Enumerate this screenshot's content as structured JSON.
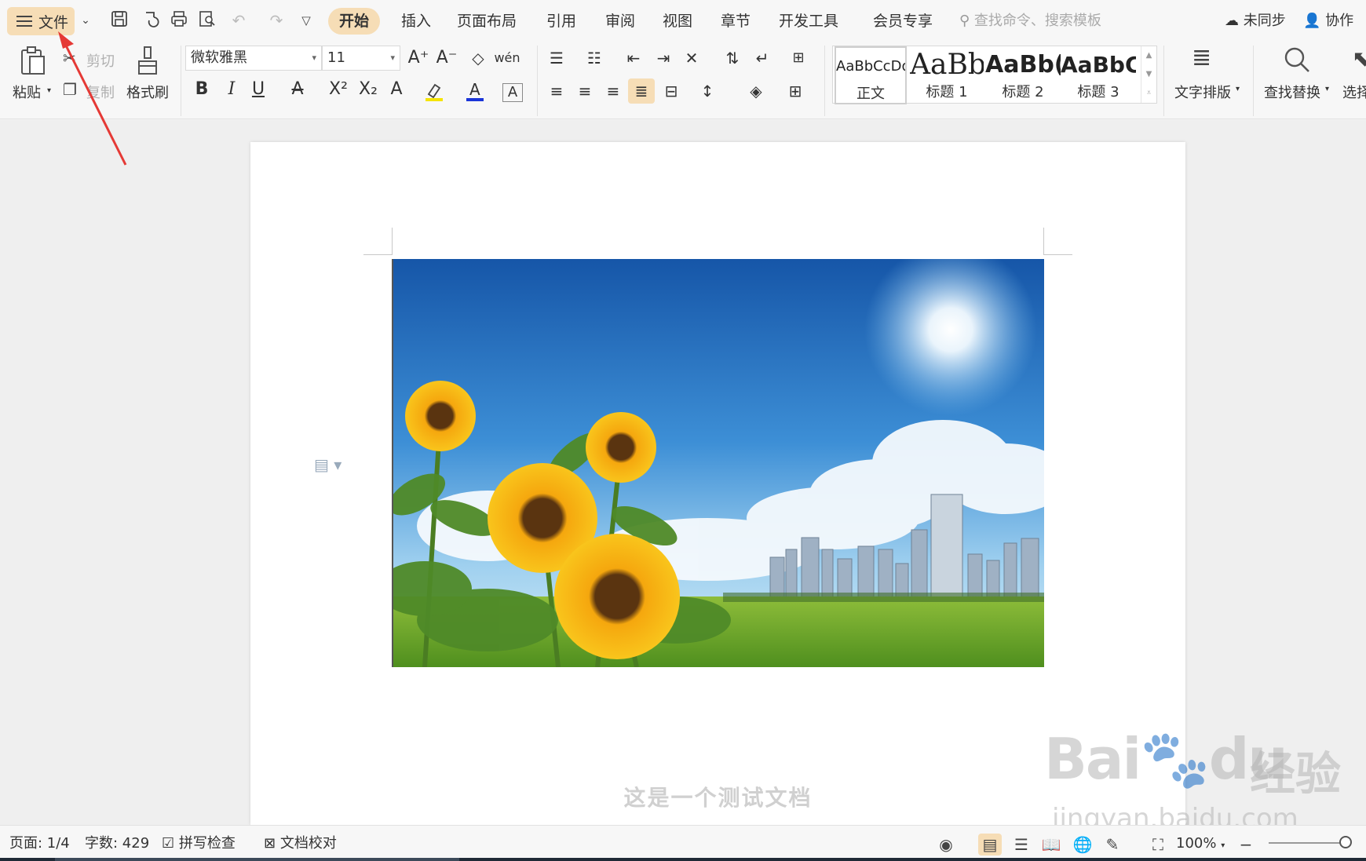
{
  "menubar": {
    "file_label": "文件",
    "tabs": [
      "开始",
      "插入",
      "页面布局",
      "引用",
      "审阅",
      "视图",
      "章节",
      "开发工具",
      "会员专享"
    ],
    "active_tab": "开始",
    "search_placeholder": "查找命令、搜索模板",
    "sync_label": "未同步",
    "collab_label": "协作"
  },
  "ribbon": {
    "paste": "粘贴",
    "cut": "剪切",
    "copy": "复制",
    "format_painter": "格式刷",
    "font_name": "微软雅黑",
    "font_size": "11",
    "styles": [
      {
        "preview": "AaBbCcDd",
        "name": "正文"
      },
      {
        "preview": "AaBb",
        "name": "标题 1"
      },
      {
        "preview": "AaBb(",
        "name": "标题 2"
      },
      {
        "preview": "AaBbC",
        "name": "标题 3"
      }
    ],
    "text_layout": "文字排版",
    "find_replace": "查找替换",
    "select": "选择",
    "font_color_accent": "#1a35d8",
    "highlight_accent": "#f5e400"
  },
  "document": {
    "body_text": "这是一个测试文档"
  },
  "statusbar": {
    "page": "页面: 1/4",
    "word_count": "字数: 429",
    "spell_check": "拼写检查",
    "doc_proof": "文档校对",
    "zoom": "100%"
  },
  "watermark": {
    "brand": "Bai",
    "brand2": "du",
    "cn": "经验",
    "url": "jingyan.baidu.com"
  },
  "colors": {
    "accent": "#f6ddb6",
    "arrow": "#e53935"
  }
}
